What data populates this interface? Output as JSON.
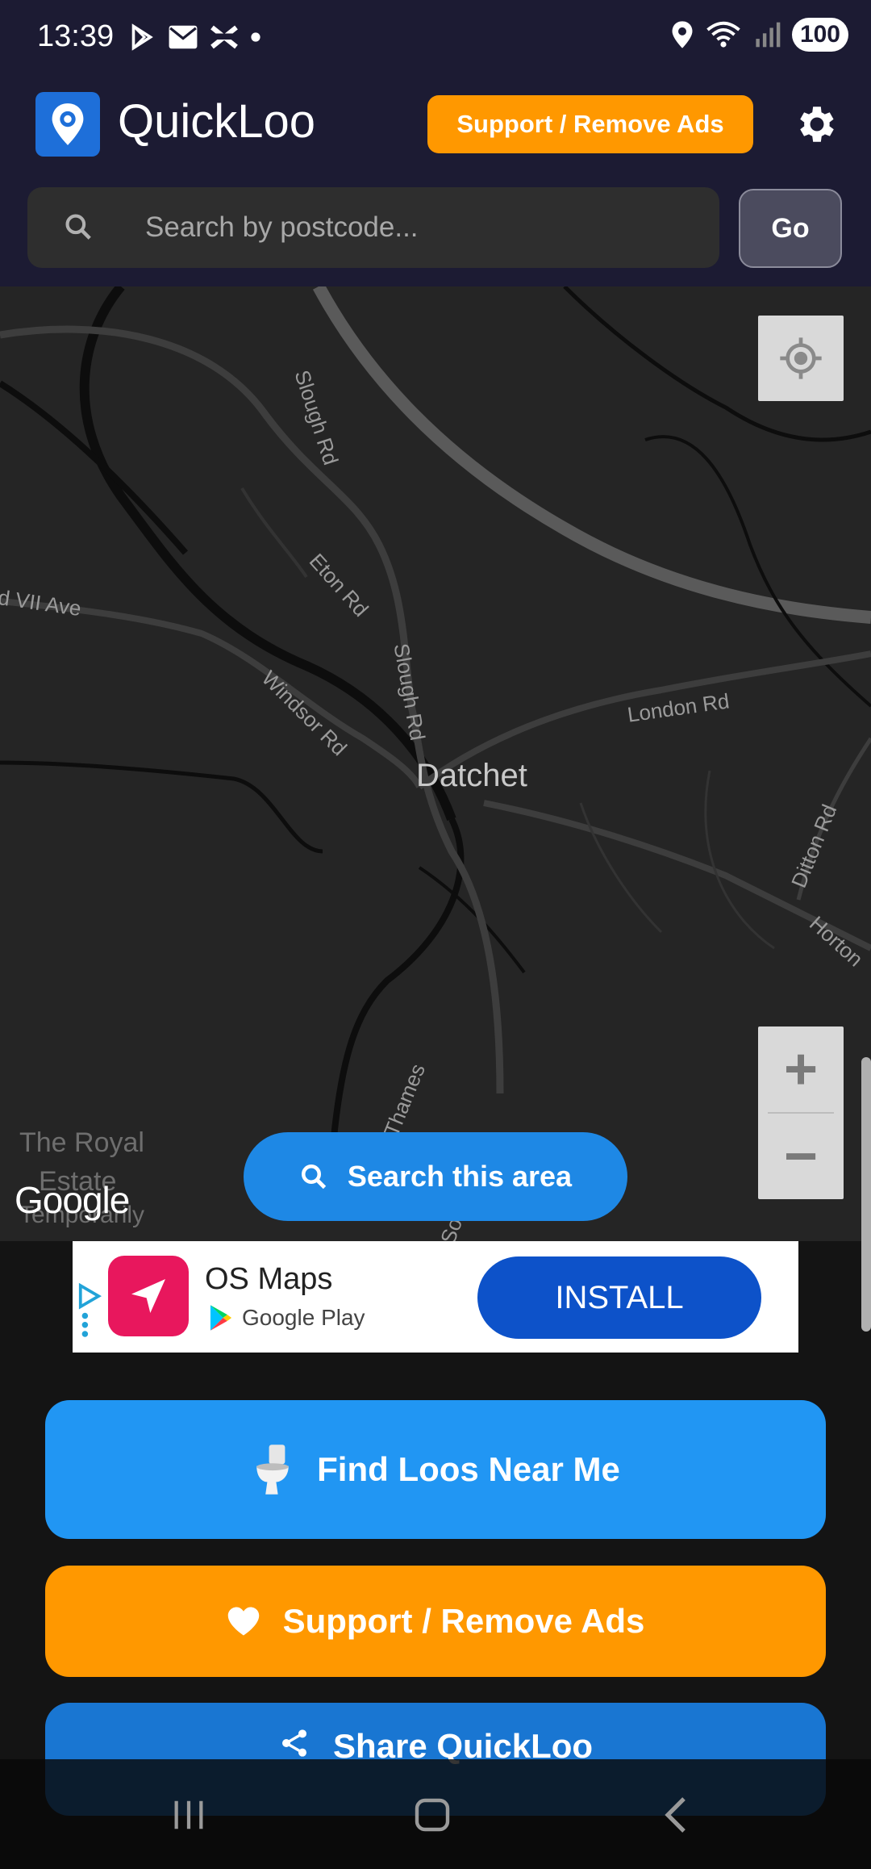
{
  "status_bar": {
    "time": "13:39",
    "battery": "100",
    "icons": [
      "play-store-icon",
      "mail-icon",
      "halifax-icon",
      "dot-icon",
      "location-icon",
      "wifi-icon",
      "signal-icon"
    ]
  },
  "app": {
    "title": "QuickLoo",
    "support_top_label": "Support / Remove Ads",
    "search_placeholder": "Search by postcode...",
    "go_label": "Go"
  },
  "map": {
    "town": "Datchet",
    "roads": [
      "Slough Rd",
      "Eton Rd",
      "Slough Rd",
      "Windsor Rd",
      "London Rd",
      "Ditton Rd",
      "Horton",
      "d VII Ave",
      "Thames",
      "The Royal",
      "Estate",
      "Temporarily",
      "Sou"
    ],
    "attribution": "Google",
    "search_area_label": "Search this area",
    "zoom_in_label": "+",
    "zoom_out_label": "−"
  },
  "ad": {
    "title": "OS Maps",
    "store": "Google Play",
    "install_label": "INSTALL"
  },
  "buttons": {
    "find_label": "Find Loos Near Me",
    "support_label": "Support / Remove Ads",
    "share_label": "Share QuickLoo"
  },
  "colors": {
    "header_bg": "#1c1b33",
    "accent_orange": "#ff9800",
    "primary_blue": "#2196f3",
    "install_blue": "#0d52c9",
    "ad_icon_pink": "#e8175d"
  }
}
